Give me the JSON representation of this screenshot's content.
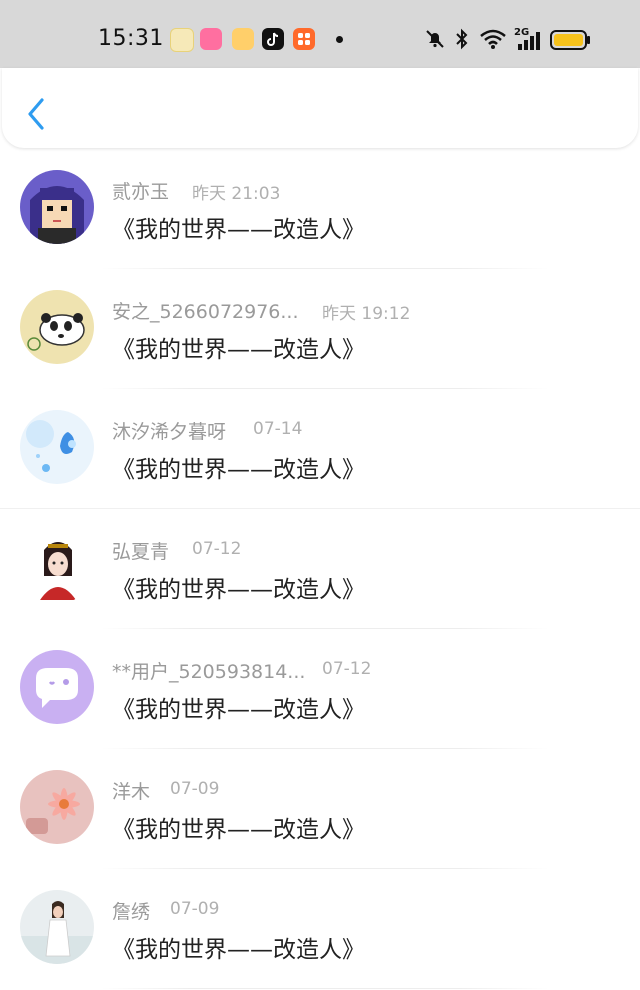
{
  "status_bar": {
    "time": "15:31",
    "network_label": "2G",
    "notification_apps": [
      "app-icon-1",
      "app-icon-2",
      "app-icon-3",
      "tiktok-icon",
      "app-icon-5"
    ]
  },
  "header": {
    "back_icon": "chevron-left-icon",
    "accent_color": "#2e9cf0"
  },
  "comments": [
    {
      "name": "贰亦玉",
      "time": "昨天 21:03",
      "content": "《我的世界——改造人》"
    },
    {
      "name": "安之_5266072976...",
      "time": "昨天 19:12",
      "content": "《我的世界——改造人》"
    },
    {
      "name": "沐汐浠夕暮呀",
      "time": "07-14",
      "content": "《我的世界——改造人》"
    },
    {
      "name": "弘夏青",
      "time": "07-12",
      "content": "《我的世界——改造人》"
    },
    {
      "name": "**用户_520593814...",
      "time": "07-12",
      "content": "《我的世界——改造人》"
    },
    {
      "name": "洋木",
      "time": "07-09",
      "content": "《我的世界——改造人》"
    },
    {
      "name": "詹绣",
      "time": "07-09",
      "content": "《我的世界——改造人》"
    }
  ]
}
